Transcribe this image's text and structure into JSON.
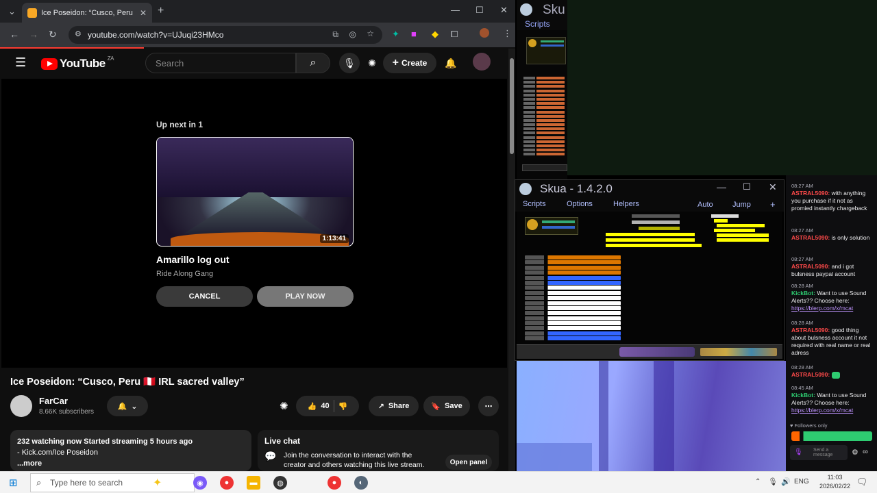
{
  "browser": {
    "tab_title": "Ice Poseidon: “Cusco, Peru",
    "url": "youtube.com/watch?v=UJuqi23HMco"
  },
  "youtube": {
    "logo_text": "YouTube",
    "country_code": "ZA",
    "search_placeholder": "Search",
    "create_label": "Create",
    "up_next_label": "Up next in",
    "up_next_count": "1",
    "next_video": {
      "title": "Amarillo log out",
      "channel": "Ride Along Gang",
      "duration": "1:13:41"
    },
    "cancel_label": "CANCEL",
    "play_now_label": "PLAY NOW",
    "video_title": "Ice Poseidon: “Cusco, Peru 🇵🇪 IRL sacred valley”",
    "channel_name": "FarCar",
    "subscribers": "8.66K subscribers",
    "like_count": "40",
    "share_label": "Share",
    "save_label": "Save",
    "description_line1": "232 watching now  Started streaming 5 hours ago",
    "description_line2": "- Kick.com/Ice Poseidon",
    "more_label": "...more",
    "live_chat_title": "Live chat",
    "live_chat_text": "Join the conversation to interact with the creator and others watching this live stream.",
    "open_panel_label": "Open panel"
  },
  "skua_top": {
    "title": "Sku",
    "menu": "Scripts"
  },
  "skua_main": {
    "title": "Skua - 1.4.2.0",
    "menu": [
      "Scripts",
      "Options",
      "Helpers"
    ],
    "menu_right": [
      "Auto",
      "Jump",
      "+"
    ]
  },
  "chat": {
    "messages": [
      {
        "time": "08:27 AM",
        "user": "ASTRAL5090:",
        "user_type": "red",
        "text": "with anything you purchase if it not as promied instantly chargeback"
      },
      {
        "time": "08:27 AM",
        "user": "ASTRAL5090:",
        "user_type": "red",
        "text": "is only solution"
      },
      {
        "time": "08:27 AM",
        "user": "ASTRAL5090:",
        "user_type": "red",
        "text": "and i got bulsness paypal account"
      },
      {
        "time": "08:28 AM",
        "user": "KickBot:",
        "user_type": "green",
        "text": "Want to use Sound Alerts?? Choose here:",
        "link": "https://blerp.com/x/mcat"
      },
      {
        "time": "08:28 AM",
        "user": "ASTRAL5090:",
        "user_type": "red",
        "text": "good thing about bulsness account it not required with real name or real adress"
      },
      {
        "time": "08:28 AM",
        "user": "ASTRAL5090:",
        "user_type": "red",
        "text": ""
      },
      {
        "time": "08:45 AM",
        "user": "KickBot:",
        "user_type": "green",
        "text": "Want to use Sound Alerts?? Choose here:",
        "link": "https://blerp.com/x/mcat"
      }
    ],
    "followers_only": "Followers only",
    "send_placeholder": "Send a message"
  },
  "taskbar": {
    "search_placeholder": "Type here to search",
    "language": "ENG",
    "time": "11:03",
    "date": "2026/02/22"
  },
  "colors": {
    "youtube_red": "#ff0000",
    "chat_red_user": "#ff4a4a",
    "chat_green_user": "#2ecc71",
    "chat_link": "#bf94ff",
    "skua_menu": "#b3c0ff"
  }
}
